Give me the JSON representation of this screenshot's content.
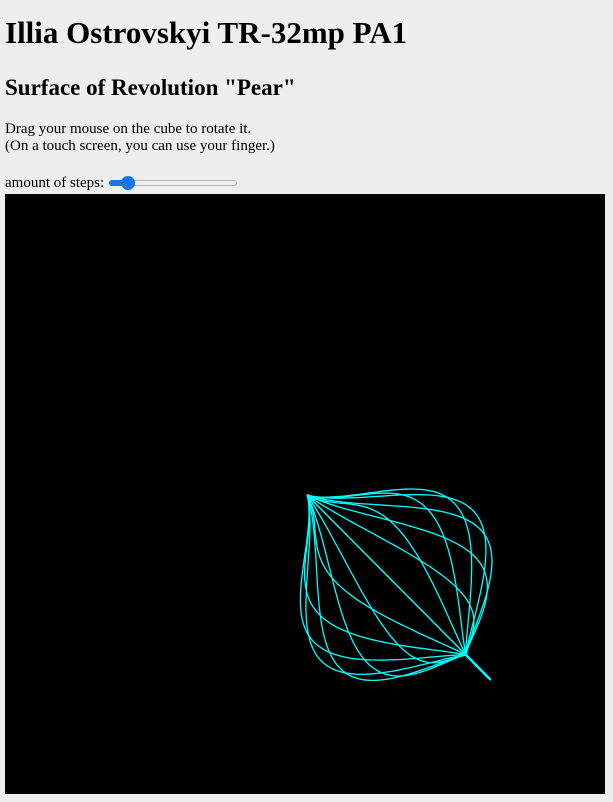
{
  "header": {
    "title": "Illia Ostrovskyi TR-32mp PA1",
    "subtitle": "Surface of Revolution \"Pear\""
  },
  "instructions": {
    "line1": "Drag your mouse on the cube to rotate it.",
    "line2": "(On a touch screen, you can use your finger.)"
  },
  "controls": {
    "steps_label": "amount of steps:",
    "steps_fraction": 0.1,
    "slider_color": "#1a73e8"
  },
  "viewport": {
    "background": "#000000",
    "wire_color": "#00ffff"
  }
}
